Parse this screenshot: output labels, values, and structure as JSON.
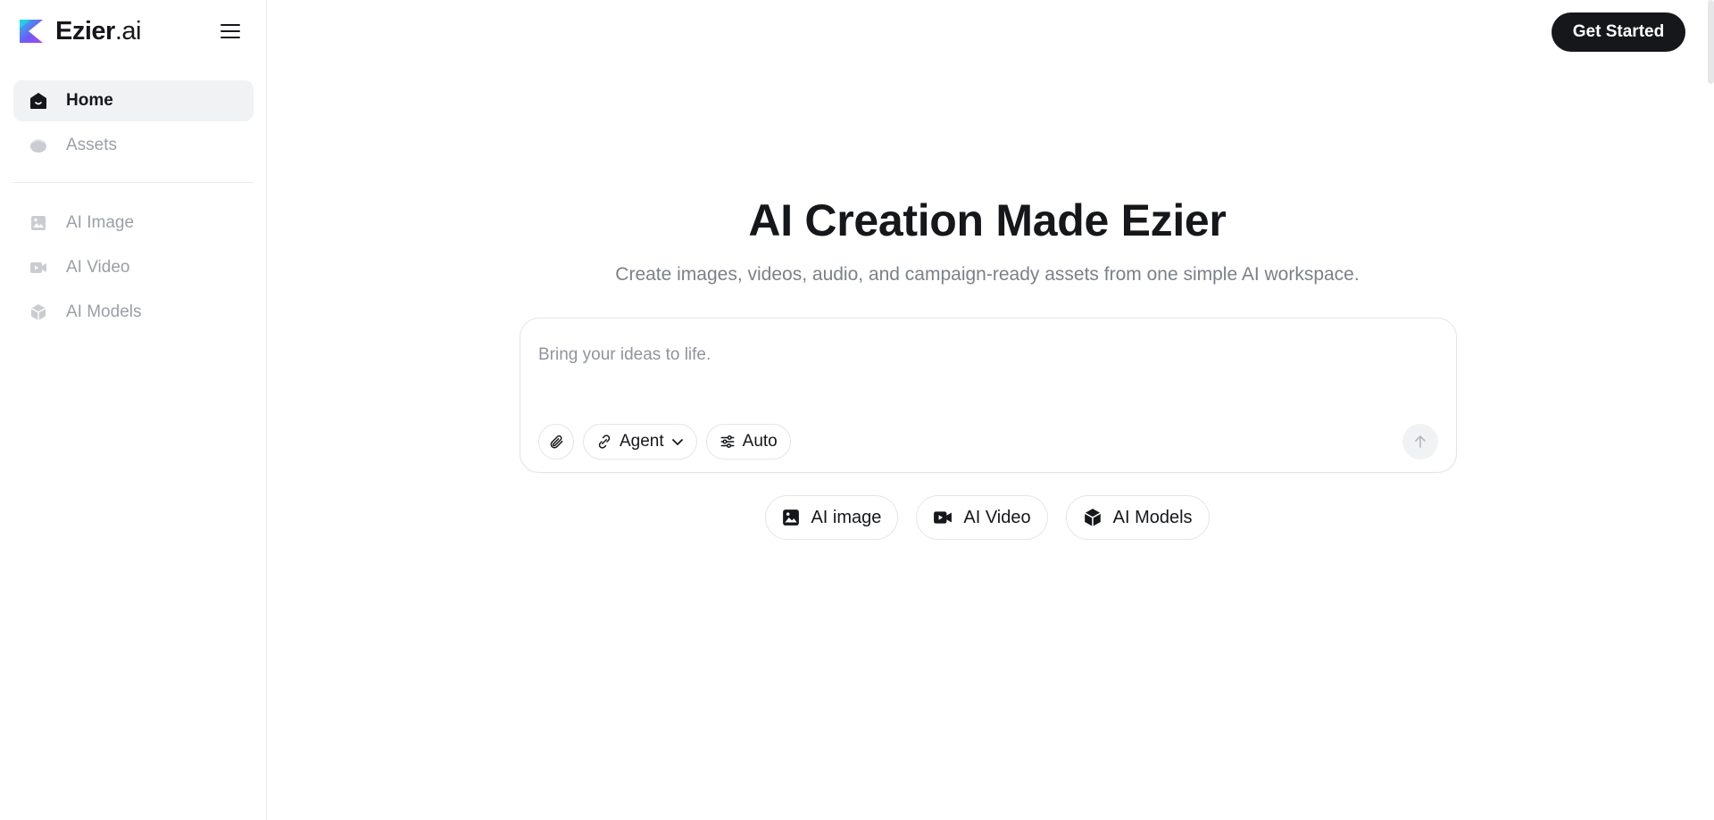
{
  "brand": {
    "name": "Ezier",
    "suffix": ".ai"
  },
  "sidebar": {
    "items": [
      {
        "label": "Home",
        "icon": "home-icon",
        "active": true
      },
      {
        "label": "Assets",
        "icon": "assets-icon",
        "active": false
      },
      {
        "label": "AI Image",
        "icon": "image-icon",
        "active": false
      },
      {
        "label": "AI Video",
        "icon": "video-icon",
        "active": false
      },
      {
        "label": "AI Models",
        "icon": "cube-icon",
        "active": false
      }
    ]
  },
  "header": {
    "cta_label": "Get Started"
  },
  "hero": {
    "title": "AI Creation Made Ezier",
    "subtitle": "Create images, videos, audio, and campaign-ready assets from one simple AI workspace."
  },
  "prompt": {
    "placeholder": "Bring your ideas to life.",
    "value": "",
    "agent_label": "Agent",
    "auto_label": "Auto"
  },
  "quick_actions": [
    {
      "label": "AI image",
      "icon": "image-icon"
    },
    {
      "label": "AI Video",
      "icon": "video-icon"
    },
    {
      "label": "AI Models",
      "icon": "cube-icon"
    }
  ],
  "colors": {
    "primary": "#15171a",
    "muted_text": "#9aa0a7",
    "active_bg": "#f1f2f3",
    "border": "#e3e5e8",
    "logo_gradient_start": "#27c4e8",
    "logo_gradient_end": "#8b3cf0"
  }
}
